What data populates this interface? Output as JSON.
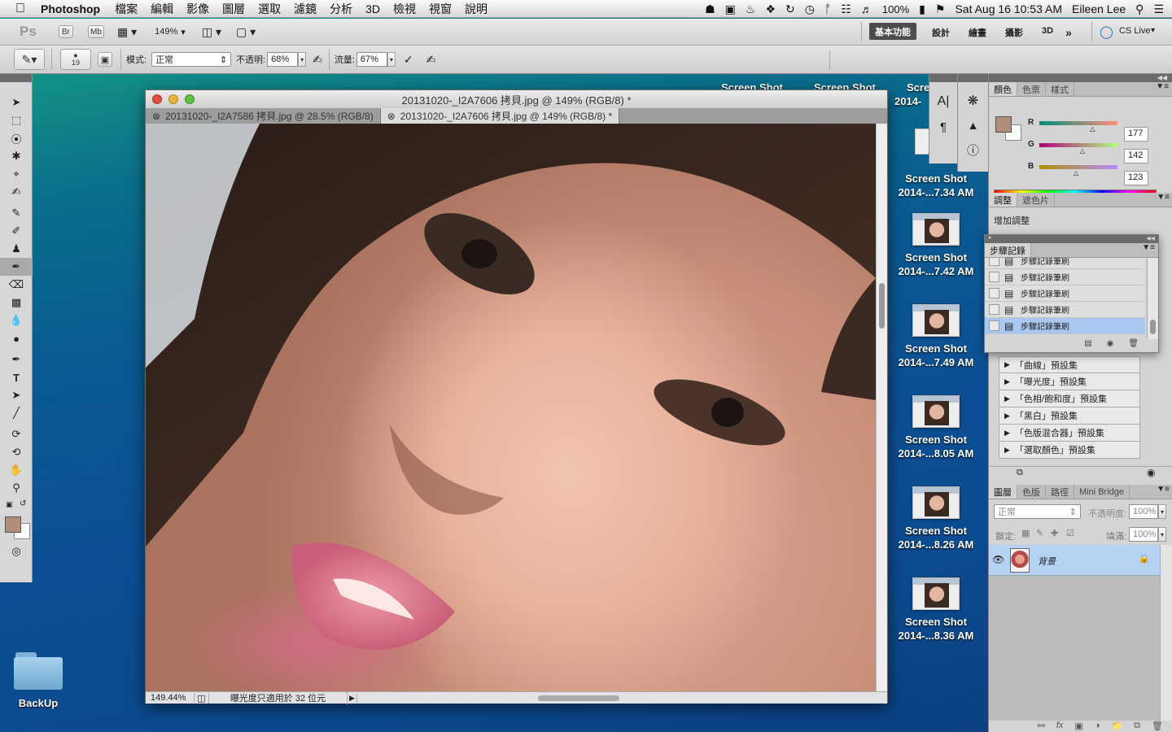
{
  "menubar": {
    "app": "Photoshop",
    "items": [
      "檔案",
      "編輯",
      "影像",
      "圖層",
      "選取",
      "濾鏡",
      "分析",
      "3D",
      "檢視",
      "視窗",
      "說明"
    ],
    "status": {
      "battery": "100%",
      "datetime": "Sat Aug 16  10:53 AM",
      "user": "Eileen Lee"
    }
  },
  "appbar": {
    "logo": "Ps",
    "br": "Br",
    "mb": "Mb",
    "zoom": "149%",
    "workspace_active": "基本功能",
    "workspaces": [
      "設計",
      "繪畫",
      "攝影",
      "3D"
    ],
    "more": "»",
    "cslive": "CS Live"
  },
  "options": {
    "brush_size": "19",
    "mode_label": "模式:",
    "mode_value": "正常",
    "opacity_label": "不透明:",
    "opacity_value": "68%",
    "flow_label": "流量:",
    "flow_value": "67%"
  },
  "document": {
    "title": "20131020-_I2A7606 拷貝.jpg @ 149% (RGB/8) *",
    "tabs": [
      "20131020-_I2A7586 拷貝.jpg @ 28.5% (RGB/8)",
      "20131020-_I2A7606 拷貝.jpg @ 149% (RGB/8) *"
    ],
    "zoom": "149.44%",
    "status": "曝光度只適用於 32 位元"
  },
  "desktop": {
    "top_labels": [
      "Screen Shot",
      "Screen Shot",
      "Scre"
    ],
    "partial": "2014-",
    "items": [
      {
        "line1": "Screen Shot",
        "line2": "2014-...7.34 AM"
      },
      {
        "line1": "Screen Shot",
        "line2": "2014-...7.42 AM"
      },
      {
        "line1": "Screen Shot",
        "line2": "2014-...7.49 AM"
      },
      {
        "line1": "Screen Shot",
        "line2": "2014-...8.05 AM"
      },
      {
        "line1": "Screen Shot",
        "line2": "2014-...8.26 AM"
      },
      {
        "line1": "Screen Shot",
        "line2": "2014-...8.36 AM"
      }
    ],
    "folder": "BackUp"
  },
  "color_panel": {
    "tabs": [
      "顏色",
      "色票",
      "樣式"
    ],
    "channels": [
      {
        "label": "R",
        "value": "177",
        "pos": 0.69
      },
      {
        "label": "G",
        "value": "142",
        "pos": 0.56
      },
      {
        "label": "B",
        "value": "123",
        "pos": 0.48
      }
    ],
    "fg": "#b18e7b"
  },
  "adjust_panel": {
    "tabs": [
      "調整",
      "遮色片"
    ],
    "heading": "增加調整",
    "presets": [
      "「曲線」預設集",
      "「曝光度」預設集",
      "「色相/飽和度」預設集",
      "「黑白」預設集",
      "「色版混合器」預設集",
      "「選取顏色」預設集"
    ]
  },
  "history_panel": {
    "tab": "步驟記錄",
    "rows": [
      "步驟記錄筆刷",
      "步驟記錄筆刷",
      "步驟記錄筆刷",
      "步驟記錄筆刷",
      "步驟記錄筆刷"
    ],
    "selected_index": 4
  },
  "layers_panel": {
    "tabs": [
      "圖層",
      "色版",
      "路徑",
      "Mini Bridge"
    ],
    "blend": "正常",
    "opacity_label": "不透明度:",
    "opacity": "100%",
    "lock_label": "鎖定:",
    "fill_label": "填滿:",
    "fill": "100%",
    "layer_name": "背景"
  }
}
